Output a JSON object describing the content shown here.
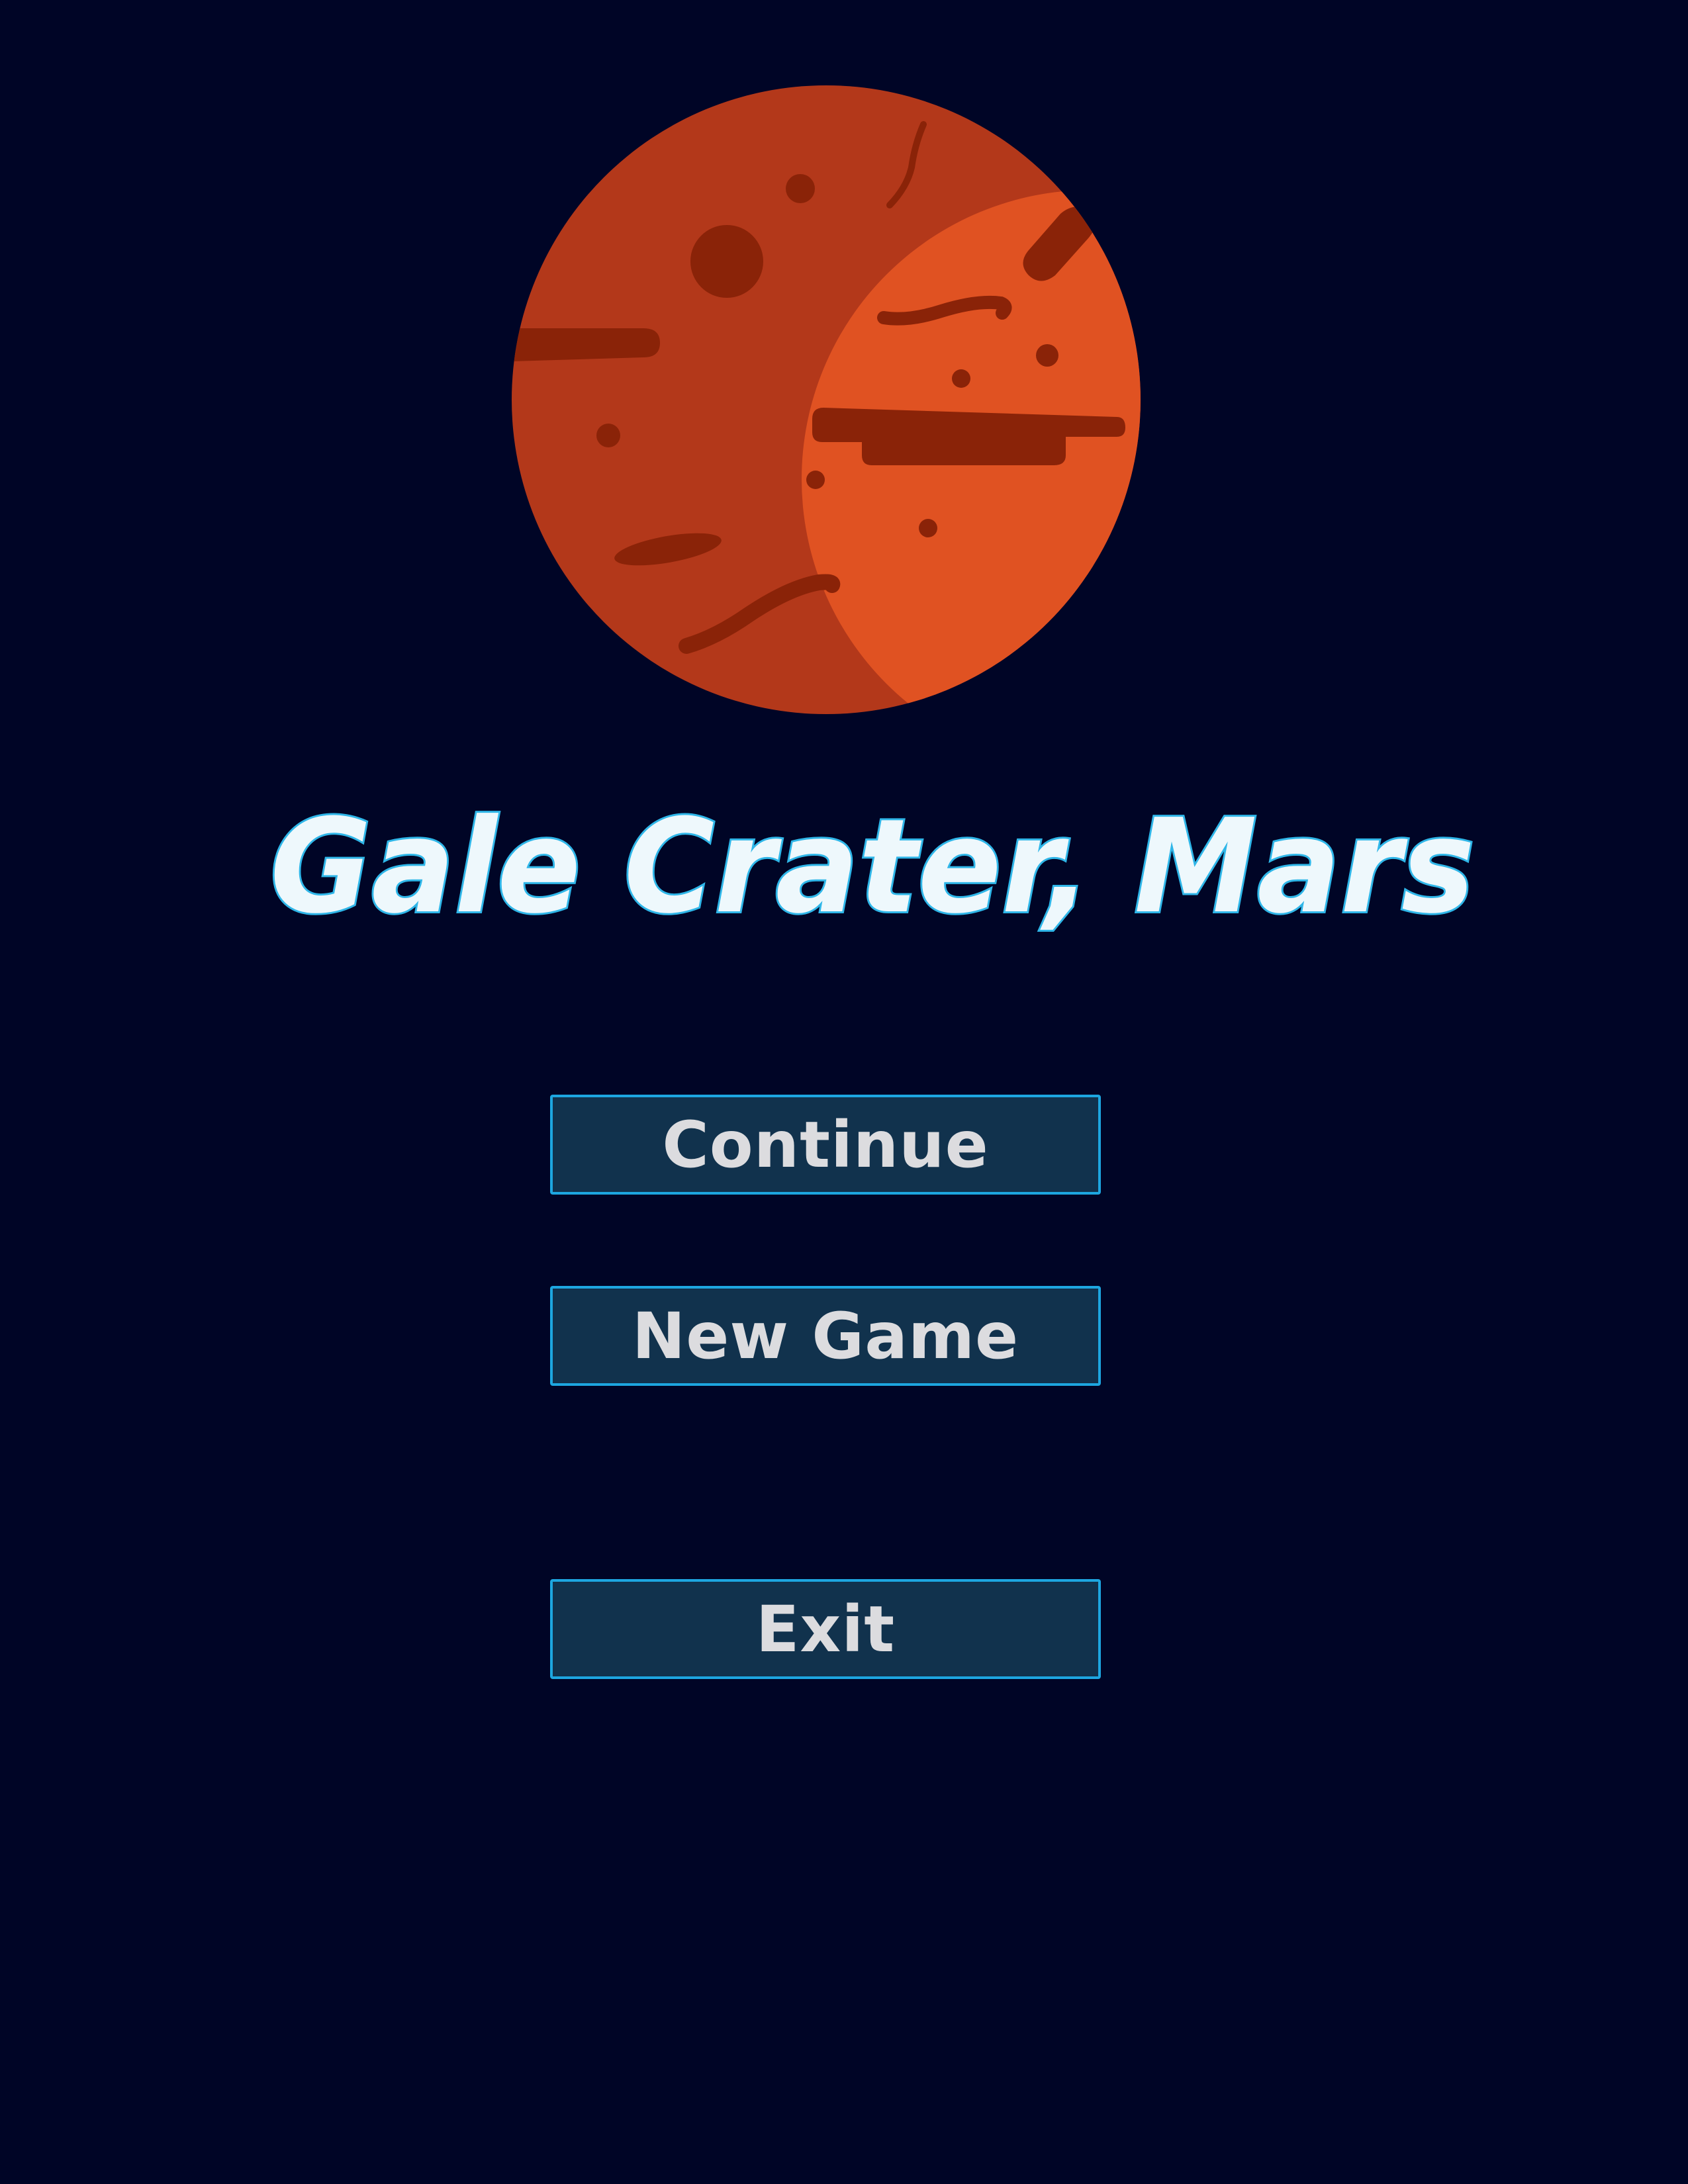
{
  "title": {
    "text": "Gale Crater, Mars",
    "fill_color": "#eef8fc",
    "outline_color": "#2fb6e8"
  },
  "planet": {
    "name": "mars",
    "colors": {
      "dark_side": "#b3381a",
      "light_side": "#e05222",
      "features": "#8a2308"
    }
  },
  "menu": {
    "continue_label": "Continue",
    "new_game_label": "New Game",
    "exit_label": "Exit"
  },
  "theme": {
    "background": "#000526",
    "button_fill": "#11324d",
    "button_border": "#1da6e0",
    "button_text": "#dcdcdf"
  }
}
